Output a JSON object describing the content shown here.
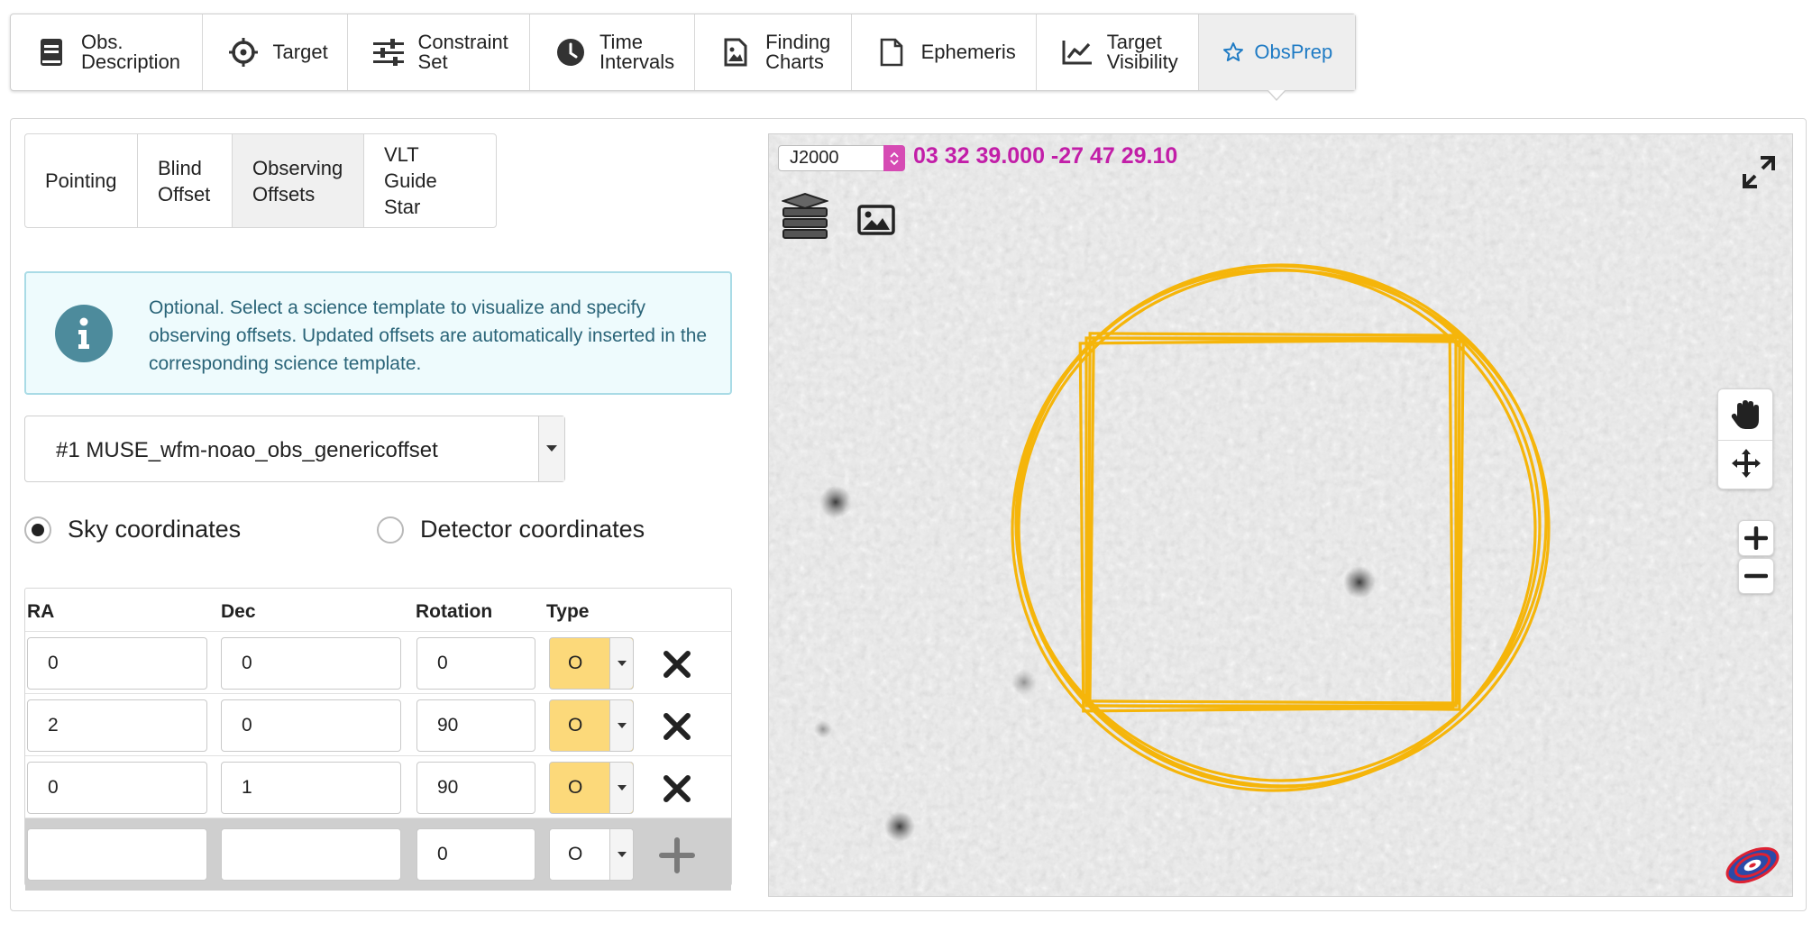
{
  "top_tabs": [
    {
      "label": "Obs.\nDescription",
      "icon": "book-icon"
    },
    {
      "label": "Target",
      "icon": "crosshair-icon"
    },
    {
      "label": "Constraint\nSet",
      "icon": "sliders-icon"
    },
    {
      "label": "Time\nIntervals",
      "icon": "clock-icon"
    },
    {
      "label": "Finding\nCharts",
      "icon": "image-file-icon"
    },
    {
      "label": "Ephemeris",
      "icon": "file-icon"
    },
    {
      "label": "Target\nVisibility",
      "icon": "line-chart-icon"
    },
    {
      "label": "ObsPrep",
      "icon": "star-icon",
      "active": true
    }
  ],
  "sub_tabs": [
    {
      "label": "Pointing"
    },
    {
      "label": "Blind\nOffset"
    },
    {
      "label": "Observing\nOffsets",
      "active": true
    },
    {
      "label": "VLT Guide\nStar"
    }
  ],
  "alert": {
    "icon": "info-icon",
    "text": "Optional. Select a science template to visualize and specify observing offsets. Updated offsets are automatically inserted in the corresponding science template."
  },
  "template_select": {
    "value": "#1 MUSE_wfm-noao_obs_genericoffset"
  },
  "coordinate_mode": {
    "sky_label": "Sky coordinates",
    "detector_label": "Detector coordinates",
    "selected": "sky"
  },
  "offsets_table": {
    "headers": {
      "ra": "RA",
      "dec": "Dec",
      "rotation": "Rotation",
      "type": "Type"
    },
    "rows": [
      {
        "ra": "0",
        "dec": "0",
        "rotation": "0",
        "type": "O"
      },
      {
        "ra": "2",
        "dec": "0",
        "rotation": "90",
        "type": "O"
      },
      {
        "ra": "0",
        "dec": "1",
        "rotation": "90",
        "type": "O"
      }
    ],
    "new_row": {
      "ra": "",
      "dec": "",
      "rotation": "0",
      "type": "O"
    }
  },
  "sky_view": {
    "frame": "J2000",
    "coordinates": "03 32 39.000 -27 47 29.10",
    "overlay_color": "#f5b50a",
    "coord_color": "#c21ea8"
  },
  "colors": {
    "active_tab_text": "#1f7bc4",
    "type_fill": "#fcd97a",
    "alert_text": "#2a6478"
  }
}
